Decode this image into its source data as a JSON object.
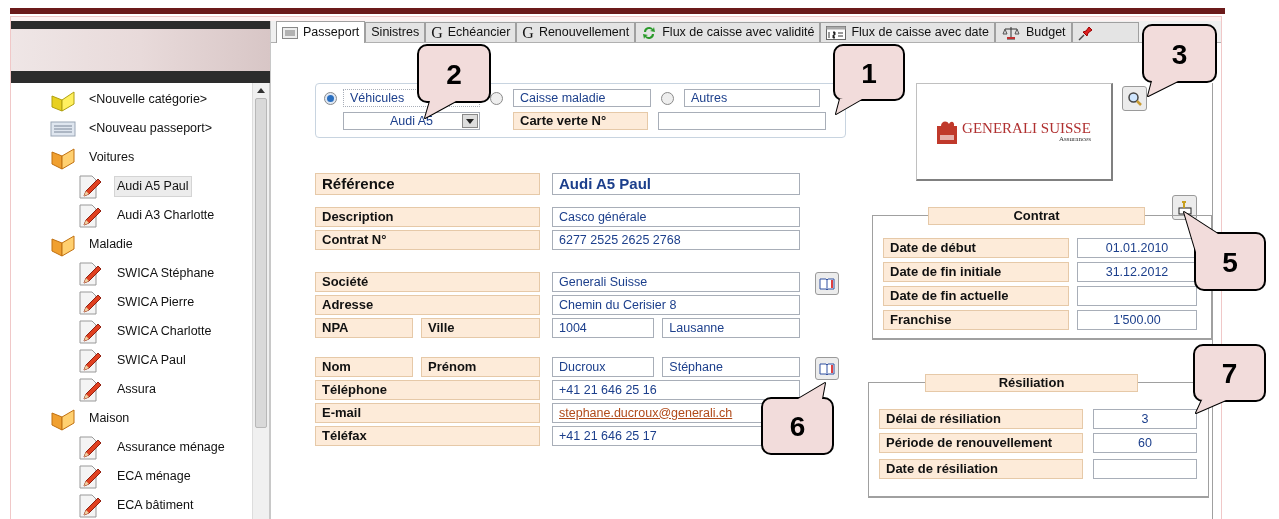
{
  "tree": [
    {
      "kind": "new-category",
      "label": "<Nouvelle catégorie>",
      "selected": false
    },
    {
      "kind": "new-passport",
      "label": "<Nouveau passeport>",
      "selected": false
    },
    {
      "kind": "category",
      "label": "Voitures",
      "selected": false,
      "children": [
        {
          "label": "Audi A5 Paul",
          "selected": true
        },
        {
          "label": "Audi A3 Charlotte",
          "selected": false
        }
      ]
    },
    {
      "kind": "category",
      "label": "Maladie",
      "selected": false,
      "children": [
        {
          "label": "SWICA Stéphane",
          "selected": false
        },
        {
          "label": "SWICA Pierre",
          "selected": false
        },
        {
          "label": "SWICA Charlotte",
          "selected": false
        },
        {
          "label": "SWICA Paul",
          "selected": false
        },
        {
          "label": "Assura",
          "selected": false
        }
      ]
    },
    {
      "kind": "category",
      "label": "Maison",
      "selected": false,
      "children": [
        {
          "label": "Assurance ménage",
          "selected": false
        },
        {
          "label": "ECA ménage",
          "selected": false
        },
        {
          "label": "ECA bâtiment",
          "selected": false
        }
      ]
    }
  ],
  "tabs": [
    {
      "label": "Passeport",
      "selected": true
    },
    {
      "label": "Sinistres",
      "selected": false
    },
    {
      "glyph": "G",
      "label": "Echéancier",
      "selected": false
    },
    {
      "glyph": "G",
      "label": "Renouvellement",
      "selected": false
    },
    {
      "label": "Flux de caisse avec validité",
      "selected": false
    },
    {
      "label": "Flux de caisse avec date",
      "selected": false
    },
    {
      "label": "Budget",
      "selected": false
    },
    {
      "selected": false
    }
  ],
  "type_selector": {
    "options": [
      {
        "label": "Véhicules",
        "selected": true
      },
      {
        "label": "Caisse maladie",
        "selected": false
      },
      {
        "label": "Autres",
        "selected": false
      }
    ],
    "vehicle": "Audi A5",
    "green_card_label": "Carte verte N°"
  },
  "reference": {
    "label": "Référence",
    "value": "Audi A5 Paul"
  },
  "sections": [
    {
      "address_book": false,
      "rows": [
        {
          "labels": [
            "Description"
          ],
          "values": [
            "Casco générale"
          ]
        },
        {
          "labels": [
            "Contrat N°"
          ],
          "values": [
            "6277 2525 2625 2768"
          ]
        }
      ]
    },
    {
      "address_book": true,
      "rows": [
        {
          "labels": [
            "Société"
          ],
          "values": [
            "Generali Suisse"
          ]
        },
        {
          "labels": [
            "Adresse"
          ],
          "values": [
            "Chemin du Cerisier 8"
          ]
        },
        {
          "labels": [
            "NPA",
            "Ville"
          ],
          "values": [
            "1004",
            "Lausanne"
          ]
        }
      ]
    },
    {
      "address_book": true,
      "rows": [
        {
          "labels": [
            "Nom",
            "Prénom"
          ],
          "values": [
            "Ducroux",
            "Stéphane"
          ]
        },
        {
          "labels": [
            "Téléphone"
          ],
          "values": [
            "+41 21 646 25 16"
          ]
        },
        {
          "labels": [
            "E-mail"
          ],
          "values": [
            "stephane.ducroux@generali.ch"
          ],
          "kind": "link"
        },
        {
          "labels": [
            "Téléfax"
          ],
          "values": [
            "+41 21 646 25 17"
          ]
        }
      ]
    }
  ],
  "logo": {
    "name": "GENERALI SUISSE",
    "subtitle": "Assurances"
  },
  "contract": {
    "title": "Contrat",
    "rows": [
      {
        "label": "Date de début",
        "value": "01.01.2010"
      },
      {
        "label": "Date de fin initiale",
        "value": "31.12.2012"
      },
      {
        "label": "Date de fin actuelle"
      },
      {
        "label": "Franchise",
        "value": "1'500.00"
      }
    ]
  },
  "termination": {
    "title": "Résiliation",
    "rows": [
      {
        "label": "Délai de résiliation",
        "value": "3"
      },
      {
        "label": "Période de renouvellement",
        "value": "60"
      },
      {
        "label": "Date de résiliation"
      }
    ]
  },
  "callouts": [
    {
      "label": "1"
    },
    {
      "label": "2"
    },
    {
      "label": "3"
    },
    {
      "label": "5"
    },
    {
      "label": "6"
    },
    {
      "label": "7"
    }
  ]
}
